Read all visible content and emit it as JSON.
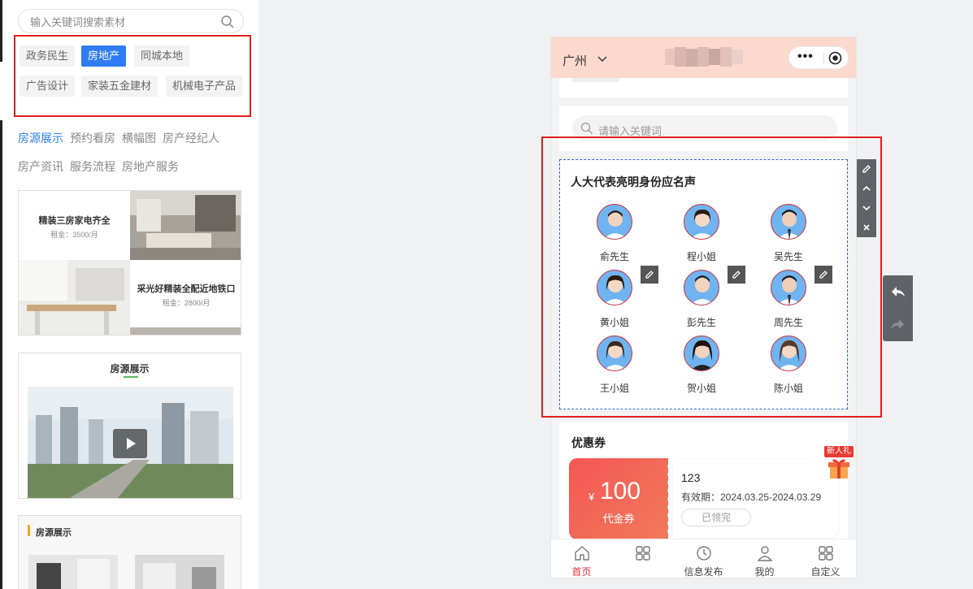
{
  "editor": {
    "search_placeholder": "输入关键词搜索素材",
    "categories": [
      "政务民生",
      "房地产",
      "同城本地",
      "广告设计",
      "家装五金建材",
      "机械电子产品"
    ],
    "active_category": "房地产",
    "sub_tabs": [
      "房源展示",
      "预约看房",
      "横幅图",
      "房产经纪人",
      "房产资讯",
      "服务流程",
      "房地产服务"
    ],
    "active_sub_tab": "房源展示",
    "templates": {
      "listing1_title": "精装三房家电齐全",
      "listing1_rent": "租金：3500/月",
      "listing2_title": "采光好精装全配近地铁口",
      "listing2_rent": "租金：2800/月",
      "video_heading": "房源展示",
      "gallery_heading": "房源展示"
    }
  },
  "phone": {
    "city": "广州",
    "search_placeholder": "请输入关键词",
    "people_title": "人大代表亮明身份应名声",
    "people": [
      "俞先生",
      "程小姐",
      "吴先生",
      "黄小姐",
      "彭先生",
      "周先生",
      "王小姐",
      "贺小姐",
      "陈小姐"
    ],
    "coupon": {
      "section_title": "优惠券",
      "currency": "¥",
      "amount": "100",
      "type_label": "代金券",
      "name": "123",
      "validity": "有效期：2024.03.25-2024.03.29",
      "status": "已领完",
      "badge": "新人礼"
    },
    "tabbar": [
      "首页",
      "",
      "信息发布",
      "我的",
      "自定义"
    ],
    "active_tab": "首页"
  },
  "colors": {
    "accent": "#2f7cf6",
    "highlight_box": "#e02020",
    "header_bg": "#fbd9cd",
    "coupon_red": "#f55656",
    "active_tab": "#e0323a"
  }
}
